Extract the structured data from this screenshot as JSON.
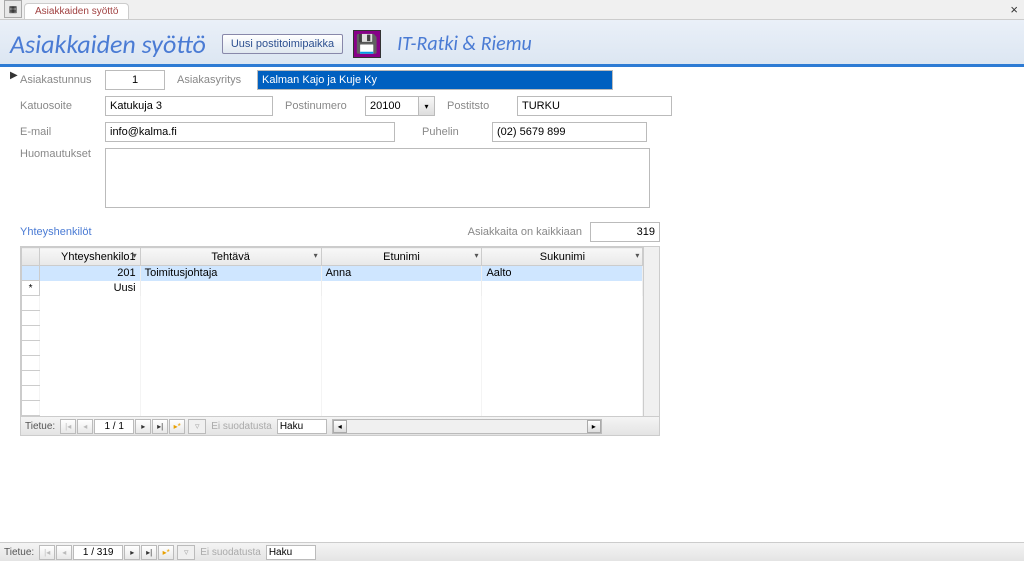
{
  "tab": {
    "label": "Asiakkaiden syöttö"
  },
  "header": {
    "title": "Asiakkaiden syöttö",
    "post_btn": "Uusi postitoimipaikka",
    "company": "IT-Ratki & Riemu"
  },
  "form": {
    "labels": {
      "id": "Asiakastunnus",
      "company": "Asiakasyritys",
      "street": "Katuosoite",
      "postcode": "Postinumero",
      "city": "Postitsto",
      "email": "E-mail",
      "phone": "Puhelin",
      "notes": "Huomautukset"
    },
    "values": {
      "id": "1",
      "company": "Kalman Kajo ja Kuje Ky",
      "street": "Katukuja 3",
      "postcode": "20100",
      "city": "TURKU",
      "email": "info@kalma.fi",
      "phone": "(02) 5679 899",
      "notes": ""
    }
  },
  "contacts": {
    "title": "Yhteyshenkilöt",
    "count_label": "Asiakkaita on kaikkiaan",
    "count": "319",
    "columns": {
      "id": "Yhteyshenkilo1",
      "task": "Tehtävä",
      "firstname": "Etunimi",
      "lastname": "Sukunimi"
    },
    "rows": [
      {
        "id": "201",
        "task": "Toimitusjohtaja",
        "firstname": "Anna",
        "lastname": "Aalto"
      }
    ],
    "new_row_label": "Uusi"
  },
  "nav_sub": {
    "label": "Tietue:",
    "position": "1 / 1",
    "filter": "Ei suodatusta",
    "search": "Haku"
  },
  "nav_main": {
    "label": "Tietue:",
    "position": "1 / 319",
    "filter": "Ei suodatusta",
    "search": "Haku"
  }
}
